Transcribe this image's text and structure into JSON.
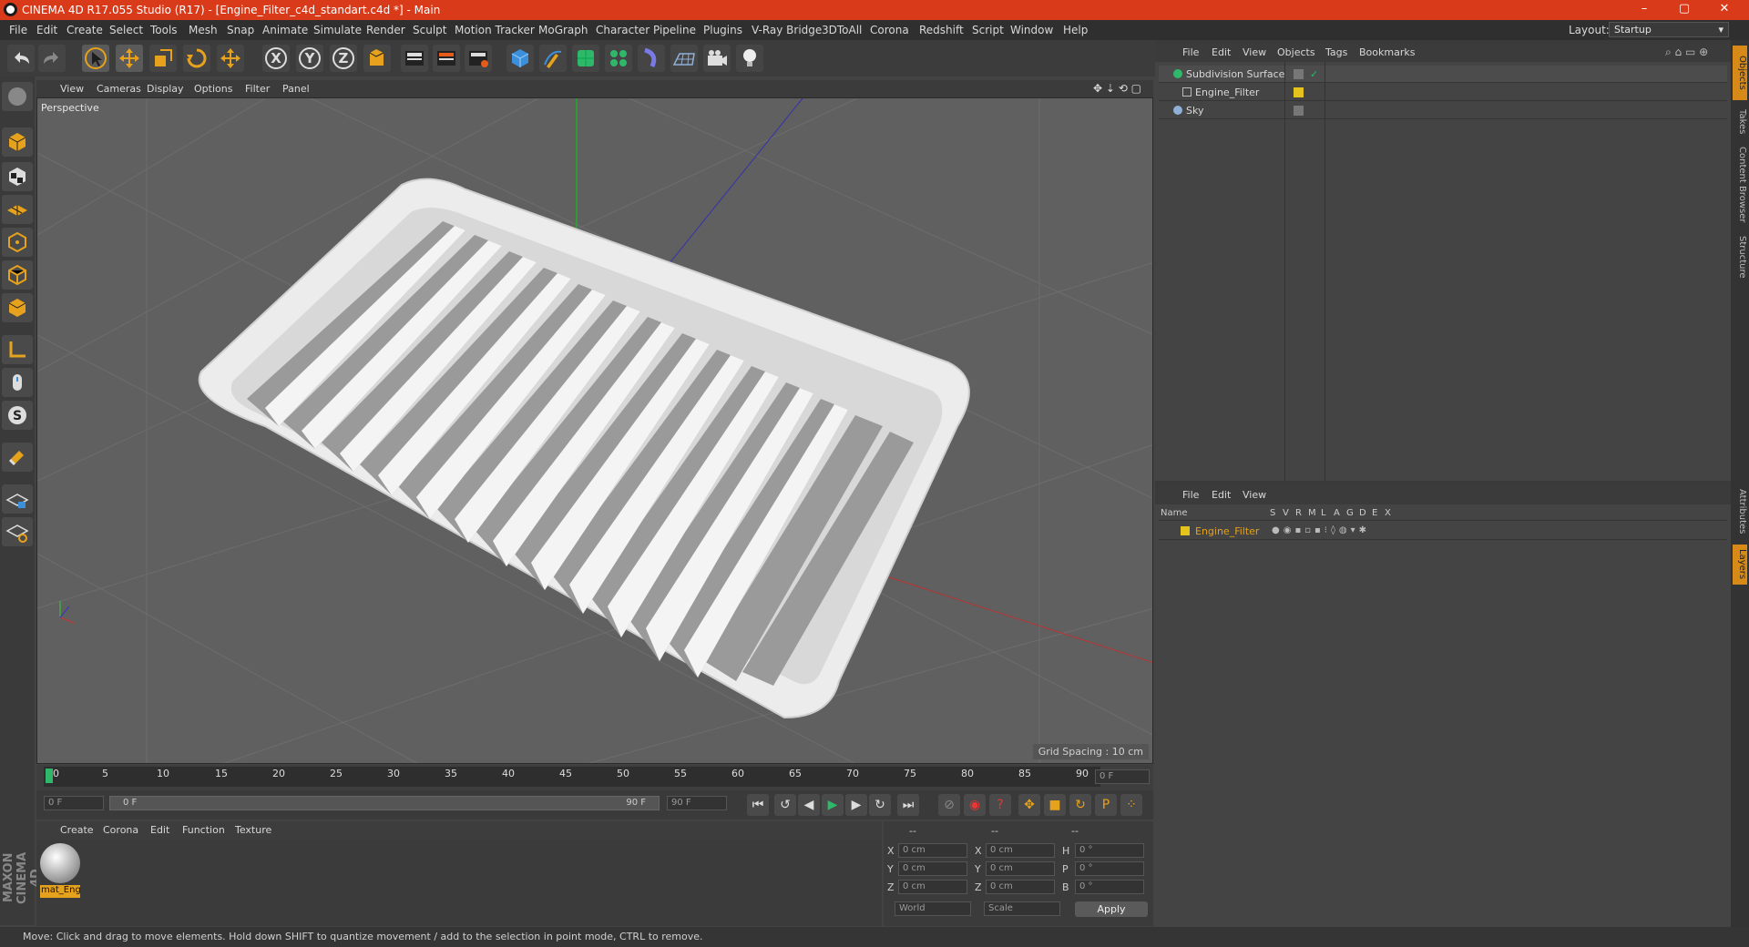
{
  "window": {
    "title": "CINEMA 4D R17.055 Studio (R17) - [Engine_Filter_c4d_standart.c4d *] - Main",
    "controls": [
      "–",
      "▢",
      "✕"
    ]
  },
  "menubar": {
    "items": [
      "File",
      "Edit",
      "Create",
      "Select",
      "Tools",
      "Mesh",
      "Snap",
      "Animate",
      "Simulate",
      "Render",
      "Sculpt",
      "Motion Tracker",
      "MoGraph",
      "Character",
      "Pipeline",
      "Plugins",
      "V-Ray Bridge",
      "3DToAll",
      "Corona",
      "Redshift",
      "Script",
      "Window",
      "Help"
    ],
    "layout_label": "Layout:",
    "layout_value": "Startup"
  },
  "toolbar": {
    "icons": [
      "undo-icon",
      "redo-icon",
      "select-arrow-icon",
      "move-icon",
      "scale-icon",
      "rotate-icon",
      "transform-icon",
      "x-axis-icon",
      "y-axis-icon",
      "z-axis-icon",
      "coordinate-system-icon",
      "render-view-icon",
      "render-picture-viewer-icon",
      "edit-render-settings-icon",
      "cube-icon",
      "pen-icon",
      "subdivision-icon",
      "cloner-icon",
      "deformer-icon",
      "floor-icon",
      "camera-icon",
      "light-icon"
    ],
    "axis_labels": [
      "X",
      "Y",
      "Z"
    ]
  },
  "viewport": {
    "menu": [
      "View",
      "Cameras",
      "Display",
      "Options",
      "Filter",
      "Panel"
    ],
    "label": "Perspective",
    "grid_spacing": "Grid Spacing : 10 cm"
  },
  "timeline": {
    "ticks": [
      "0",
      "5",
      "10",
      "15",
      "20",
      "25",
      "30",
      "35",
      "40",
      "45",
      "50",
      "55",
      "60",
      "65",
      "70",
      "75",
      "80",
      "85",
      "90"
    ],
    "current_frame": "0 F",
    "start_field": "0 F",
    "range_start": "0 F",
    "range_end": "90 F",
    "end_field": "90 F"
  },
  "materials": {
    "menu": [
      "Create",
      "Corona",
      "Edit",
      "Function",
      "Texture"
    ],
    "items": [
      {
        "name": "mat_Eng"
      }
    ]
  },
  "coords": {
    "headers": [
      "--",
      "--",
      "--"
    ],
    "rows": [
      {
        "a": "X",
        "av": "0 cm",
        "b": "X",
        "bv": "0 cm",
        "c": "H",
        "cv": "0 °"
      },
      {
        "a": "Y",
        "av": "0 cm",
        "b": "Y",
        "bv": "0 cm",
        "c": "P",
        "cv": "0 °"
      },
      {
        "a": "Z",
        "av": "0 cm",
        "b": "Z",
        "bv": "0 cm",
        "c": "B",
        "cv": "0 °"
      }
    ],
    "world": "World",
    "scale": "Scale",
    "apply": "Apply"
  },
  "object_manager": {
    "menu": [
      "File",
      "Edit",
      "View",
      "Objects",
      "Tags",
      "Bookmarks"
    ],
    "objects": [
      {
        "name": "Subdivision Surface",
        "color": "#49c97a"
      },
      {
        "name": "Engine_Filter",
        "color": "#cfcfcf"
      },
      {
        "name": "Sky",
        "color": "#8fb0d8"
      }
    ]
  },
  "layer_manager": {
    "menu": [
      "File",
      "Edit",
      "View"
    ],
    "columns": [
      "Name",
      "S",
      "V",
      "R",
      "M",
      "L",
      "A",
      "G",
      "D",
      "E",
      "X"
    ],
    "layers": [
      {
        "name": "Engine_Filter",
        "color": "#e6c21c"
      }
    ]
  },
  "right_tabs": [
    "Objects",
    "Takes",
    "Content Browser",
    "Structure",
    "Attributes",
    "Layers"
  ],
  "brand": "MAXON CINEMA 4D",
  "status": "Move: Click and drag to move elements. Hold down SHIFT to quantize movement / add to the selection in point mode, CTRL to remove.",
  "colors": {
    "accent": "#e6a21c",
    "title_bar": "#d93a1a"
  }
}
